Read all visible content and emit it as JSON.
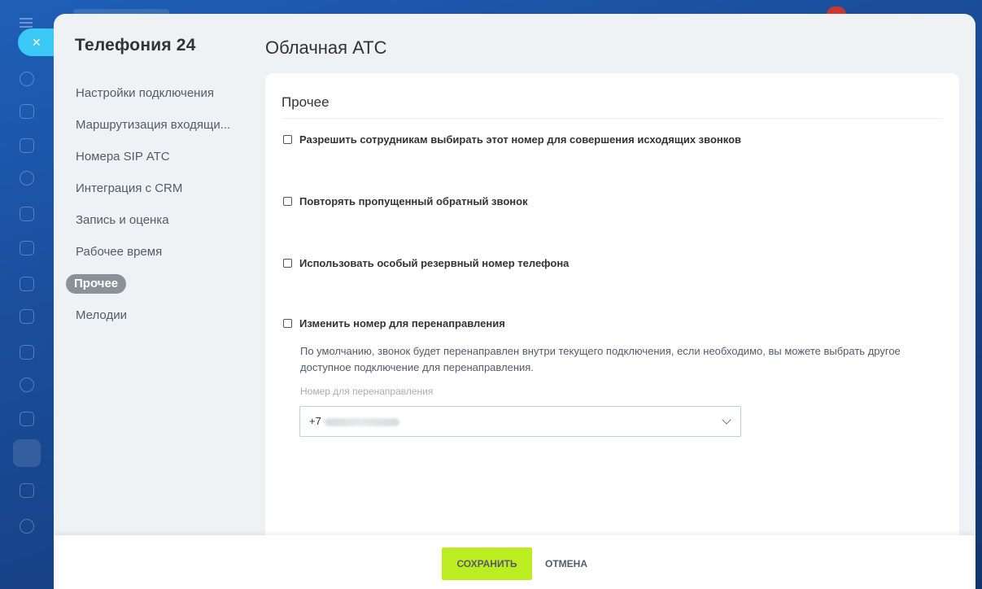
{
  "app": {
    "slider_title": "Телефония 24",
    "page_title": "Облачная АТС",
    "notification_count": ""
  },
  "sidebar": {
    "items": [
      {
        "label": "Настройки подключения",
        "active": false
      },
      {
        "label": "Маршрутизация входящи...",
        "active": false
      },
      {
        "label": "Номера SIP АТС",
        "active": false
      },
      {
        "label": "Интеграция с CRM",
        "active": false
      },
      {
        "label": "Запись и оценка",
        "active": false
      },
      {
        "label": "Рабочее время",
        "active": false
      },
      {
        "label": "Прочее",
        "active": true
      },
      {
        "label": "Мелодии",
        "active": false
      }
    ]
  },
  "section": {
    "title": "Прочее",
    "options": [
      {
        "label": "Разрешить сотрудникам выбирать этот номер для совершения исходящих звонков",
        "checked": false
      },
      {
        "label": "Повторять пропущенный обратный звонок",
        "checked": false
      },
      {
        "label": "Использовать особый резервный номер телефона",
        "checked": false
      },
      {
        "label": "Изменить номер для перенаправления",
        "checked": false
      }
    ],
    "redirect_hint": "По умолчанию, звонок будет перенаправлен внутри текущего подключения, если необходимо, вы можете выбрать другое доступное подключение для перенаправления.",
    "redirect_field_label": "Номер для перенаправления",
    "redirect_value_prefix": "+7"
  },
  "footer": {
    "save_label": "СОХРАНИТЬ",
    "cancel_label": "ОТМЕНА"
  },
  "colors": {
    "accent_save": "#bbed21",
    "close_button": "#3bc8f5",
    "active_nav": "#8a9199"
  }
}
